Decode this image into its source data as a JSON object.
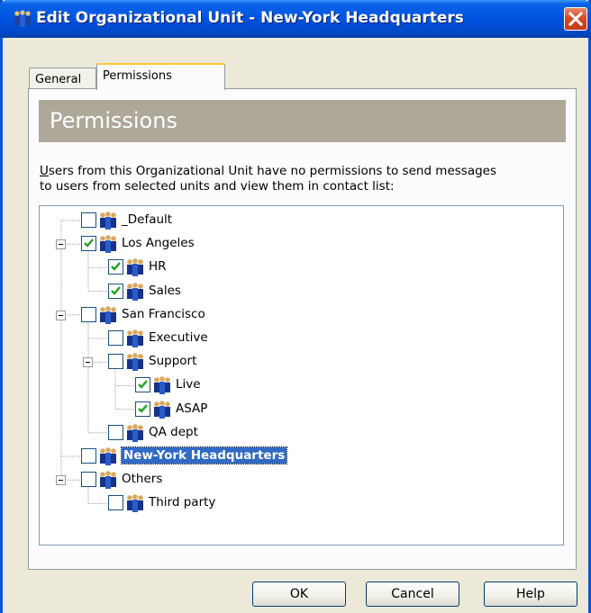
{
  "window": {
    "title": "Edit Organizational Unit - New-York Headquarters"
  },
  "tabs": [
    {
      "label": "General"
    },
    {
      "label": "Permissions"
    }
  ],
  "panel": {
    "header": "Permissions",
    "description_line1_first": "U",
    "description_line1_rest": "sers from this Organizational Unit have no permissions to send messages",
    "description_line2": "to users from selected units and view them in contact list:"
  },
  "tree": [
    {
      "label": "_Default",
      "checked": false
    },
    {
      "label": "Los Angeles",
      "checked": true,
      "expanded": true
    },
    {
      "label": "HR",
      "checked": true
    },
    {
      "label": "Sales",
      "checked": true
    },
    {
      "label": "San Francisco",
      "checked": false,
      "expanded": true
    },
    {
      "label": "Executive",
      "checked": false
    },
    {
      "label": "Support",
      "checked": false,
      "expanded": true
    },
    {
      "label": "Live",
      "checked": true
    },
    {
      "label": "ASAP",
      "checked": true
    },
    {
      "label": "QA dept",
      "checked": false
    },
    {
      "label": "New-York Headquarters",
      "checked": false,
      "selected": true
    },
    {
      "label": "Others",
      "checked": false,
      "expanded": true
    },
    {
      "label": "Third party",
      "checked": false
    }
  ],
  "buttons": {
    "ok": "OK",
    "cancel": "Cancel",
    "help": "Help"
  },
  "colors": {
    "titlebar": "#0054e3",
    "header_band": "#ada899",
    "selection": "#316ac5",
    "check": "#21a121"
  },
  "icons": {
    "unit": "group-of-people-icon",
    "close": "close-icon"
  }
}
